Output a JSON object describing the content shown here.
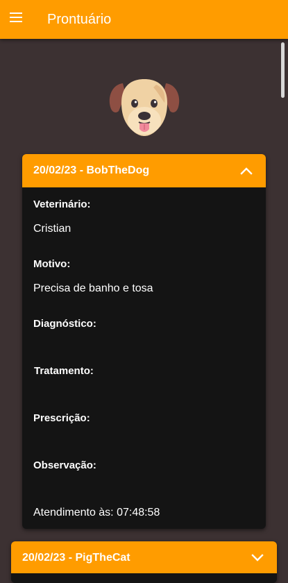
{
  "app_bar": {
    "title": "Prontuário",
    "menu_icon": "menu-icon"
  },
  "pet_avatar": {
    "icon": "dog-face-icon",
    "colors": {
      "face": "#f0d2a4",
      "ears": "#8e4f43",
      "eyes": "#3a3136",
      "tongue": "#f08a9b"
    }
  },
  "records": [
    {
      "title": "20/02/23 - BobTheDog",
      "expanded": true,
      "fields": {
        "vet_label": "Veterinário:",
        "vet_value": "Cristian",
        "reason_label": "Motivo:",
        "reason_value": "Precisa de banho e tosa",
        "diagnosis_label": "Diagnóstico:",
        "diagnosis_value": "",
        "treatment_label": "Tratamento:",
        "treatment_value": "",
        "prescription_label": "Prescrição:",
        "prescription_value": "",
        "observation_label": "Observação:",
        "observation_value": "",
        "time_text": "Atendimento às: 07:48:58"
      }
    },
    {
      "title": "20/02/23 - PigTheCat",
      "expanded": false
    }
  ],
  "colors": {
    "accent": "#ff9c00",
    "background": "#3c3132",
    "panel": "#141414",
    "text": "#ffffff"
  }
}
